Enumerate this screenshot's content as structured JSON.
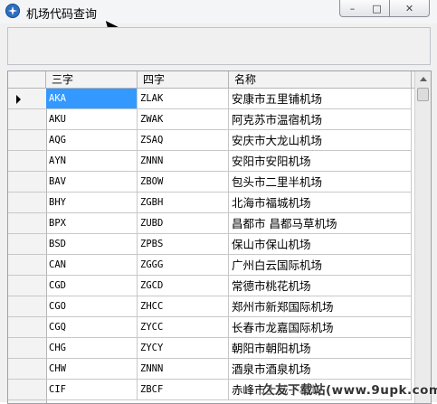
{
  "window": {
    "title": "机场代码查询",
    "icon": "app-globe-icon",
    "controls": {
      "minimize": "–",
      "maximize": "□",
      "close": "✕"
    }
  },
  "grid": {
    "columns": [
      "三字",
      "四字",
      "名称"
    ],
    "selected_row": 0,
    "rows": [
      {
        "three": "AKA",
        "four": "ZLAK",
        "name": "安康市五里铺机场"
      },
      {
        "three": "AKU",
        "four": "ZWAK",
        "name": "阿克苏市温宿机场"
      },
      {
        "three": "AQG",
        "four": "ZSAQ",
        "name": "安庆市大龙山机场"
      },
      {
        "three": "AYN",
        "four": "ZNNN",
        "name": "安阳市安阳机场"
      },
      {
        "three": "BAV",
        "four": "ZBOW",
        "name": "包头市二里半机场"
      },
      {
        "three": "BHY",
        "four": "ZGBH",
        "name": "北海市福城机场"
      },
      {
        "three": "BPX",
        "four": "ZUBD",
        "name": "昌都市 昌都马草机场"
      },
      {
        "three": "BSD",
        "four": "ZPBS",
        "name": "保山市保山机场"
      },
      {
        "three": "CAN",
        "four": "ZGGG",
        "name": "广州白云国际机场"
      },
      {
        "three": "CGD",
        "four": "ZGCD",
        "name": "常德市桃花机场"
      },
      {
        "three": "CGO",
        "four": "ZHCC",
        "name": "郑州市新郑国际机场"
      },
      {
        "three": "CGQ",
        "four": "ZYCC",
        "name": "长春市龙嘉国际机场"
      },
      {
        "three": "CHG",
        "four": "ZYCY",
        "name": "朝阳市朝阳机场"
      },
      {
        "three": "CHW",
        "four": "ZNNN",
        "name": "酒泉市酒泉机场"
      },
      {
        "three": "CIF",
        "four": "ZBCF",
        "name": "赤峰市土城子机场"
      }
    ]
  },
  "watermark": "久友下载站(www.9upk.com)"
}
